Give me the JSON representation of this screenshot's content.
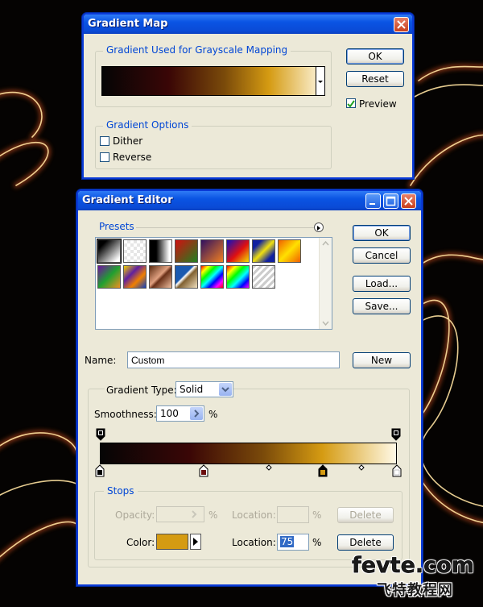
{
  "gradient_map": {
    "title": "Gradient Map",
    "used_group_label": "Gradient Used for Grayscale Mapping",
    "ok_label": "OK",
    "cancel_label": "Reset",
    "preview_label": "Preview",
    "preview_checked": true,
    "options_group_label": "Gradient Options",
    "dither_label": "Dither",
    "dither_checked": false,
    "reverse_label": "Reverse",
    "reverse_checked": false
  },
  "gradient_editor": {
    "title": "Gradient Editor",
    "presets_label": "Presets",
    "ok_label": "OK",
    "cancel_label": "Cancel",
    "load_label": "Load...",
    "save_label": "Save...",
    "name_label": "Name:",
    "name_value": "Custom",
    "new_label": "New",
    "type_label": "Gradient Type:",
    "type_value": "Solid",
    "smoothness_label": "Smoothness:",
    "smoothness_value": "100",
    "smoothness_unit": "%",
    "stops_group_label": "Stops",
    "opacity_label": "Opacity:",
    "opacity_unit": "%",
    "opacity_location_label": "Location:",
    "opacity_location_unit": "%",
    "opacity_delete_label": "Delete",
    "color_label": "Color:",
    "color_value": "#d59b12",
    "color_location_label": "Location:",
    "color_location_value": "75",
    "color_location_unit": "%",
    "color_delete_label": "Delete",
    "gradient_colors": [
      "#050505",
      "#3a0606",
      "#7a4a0a",
      "#d59b12",
      "#fff9e6"
    ],
    "color_stops": [
      {
        "location": 0,
        "color": "#000000"
      },
      {
        "location": 0.35,
        "color": "#6a0c0c"
      },
      {
        "location": 0.75,
        "color": "#d59b12"
      },
      {
        "location": 1,
        "color": "#ffffff"
      }
    ],
    "midpoints": [
      0.57,
      0.88
    ],
    "presets": [
      "black-white",
      "transparent",
      "black-white-fade",
      "red-green",
      "violet-orange",
      "blue-red-yellow",
      "blue-yellow-blue",
      "orange-yellow-orange",
      "violet-green-orange",
      "yellow-violet-orange-blue",
      "copper",
      "chrome",
      "spectrum",
      "transparent-rainbow",
      "transparent-stripes"
    ]
  },
  "watermark": {
    "site": "fevte.com",
    "cn": "飞特教程网"
  }
}
